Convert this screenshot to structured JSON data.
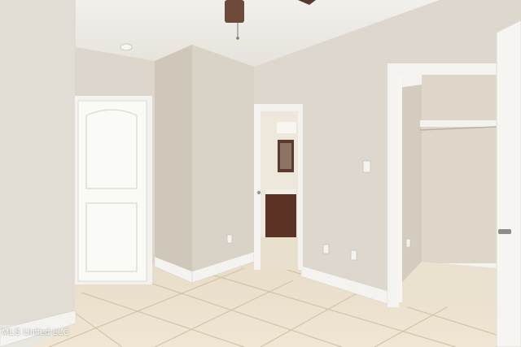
{
  "photo": {
    "kind": "real-estate interior photo",
    "watermark": "MLS United LLC"
  },
  "colors": {
    "wall": "#dcd6cc",
    "wall_shadow": "#cfc7ba",
    "ceiling": "#efece7",
    "trim": "#f4f3ef",
    "floor_tile": "#e9dcc6",
    "grout": "#d5c6ad",
    "vanity_wood": "#5c3224",
    "fan_blade": "#6e4a3a"
  },
  "icons": [
    "ceiling-fan-icon",
    "smoke-detector-icon",
    "light-switch-icon",
    "outlet-icon",
    "door-knob-icon"
  ]
}
